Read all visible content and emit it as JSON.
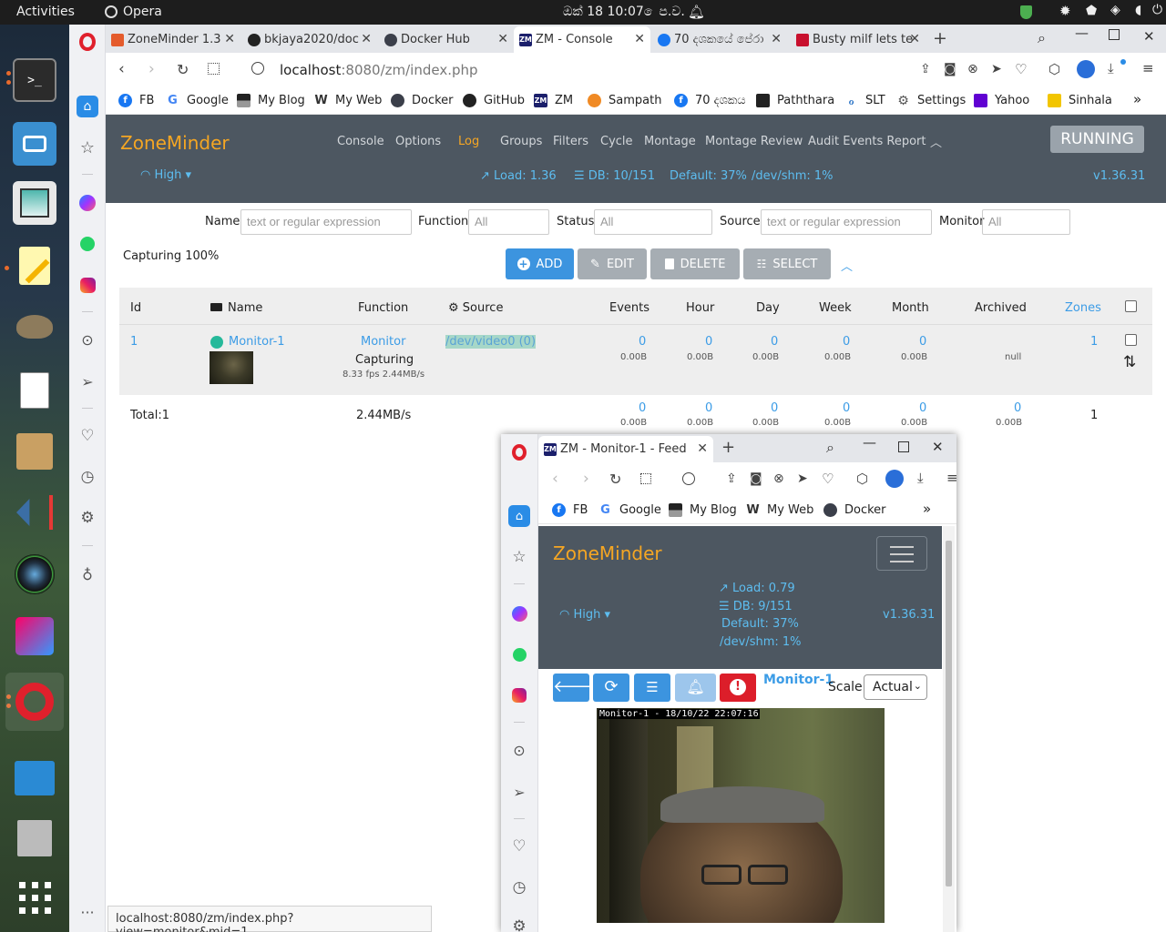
{
  "topbar": {
    "activities": "Activities",
    "app": "Opera",
    "clock": "ඔක් 18  10:07 ෙප.ව."
  },
  "tabs": [
    {
      "title": "ZoneMinder 1.3",
      "color": "#e45b2c"
    },
    {
      "title": "bkjaya2020/doc",
      "color": "#222222"
    },
    {
      "title": "Docker Hub",
      "color": "#3b3f4a"
    },
    {
      "title": "ZM - Console",
      "color": "#1b1f6b"
    },
    {
      "title": "70 දශකයේ පේරා",
      "color": "#1877f2"
    },
    {
      "title": "Busty milf lets te",
      "color": "#c8102e"
    }
  ],
  "address": {
    "host": "localhost",
    "rest": ":8080/zm/index.php"
  },
  "bookmarks": [
    {
      "label": "FB",
      "color": "#1877f2",
      "glyph": "f"
    },
    {
      "label": "Google",
      "color": "#ffffff",
      "glyph": "G"
    },
    {
      "label": "My Blog",
      "color": "#222222",
      "glyph": ""
    },
    {
      "label": "My Web",
      "color": "#ffffff",
      "glyph": "W"
    },
    {
      "label": "Docker",
      "color": "#3b3f4a",
      "glyph": ""
    },
    {
      "label": "GitHub",
      "color": "#222222",
      "glyph": ""
    },
    {
      "label": "ZM",
      "color": "#1b1f6b",
      "glyph": "ZM"
    },
    {
      "label": "Sampath",
      "color": "#f08a24",
      "glyph": ""
    },
    {
      "label": "70 දශකය",
      "color": "#1877f2",
      "glyph": "f"
    },
    {
      "label": "Paththara",
      "color": "#222222",
      "glyph": ""
    },
    {
      "label": "SLT",
      "color": "#ffffff",
      "glyph": ""
    },
    {
      "label": "Settings",
      "color": "#ffffff",
      "glyph": "⚙"
    },
    {
      "label": "Yahoo",
      "color": "#6001d2",
      "glyph": ""
    },
    {
      "label": "Sinhala",
      "color": "#f2c500",
      "glyph": ""
    }
  ],
  "zm": {
    "brand": "ZoneMinder",
    "nav": [
      "Console",
      "Options",
      "Log",
      "Groups",
      "Filters",
      "Cycle",
      "Montage",
      "Montage Review",
      "Audit Events Report"
    ],
    "state": "RUNNING",
    "bandwidth": "High",
    "load": "Load: 1.36",
    "db": "DB: 10/151",
    "default": "Default: 37%",
    "shm": "/dev/shm: 1%",
    "version": "v1.36.31",
    "accent": "#f5a623"
  },
  "filter": {
    "name_label": "Name",
    "name_ph": "text or regular expression",
    "function_label": "Function",
    "function_ph": "All",
    "status_label": "Status",
    "status_ph": "All",
    "source_label": "Source",
    "source_ph": "text or regular expression",
    "monitor_label": "Monitor",
    "monitor_ph": "All"
  },
  "capturing": "Capturing 100%",
  "actions": {
    "add": "ADD",
    "edit": "EDIT",
    "delete": "DELETE",
    "select": "SELECT"
  },
  "table": {
    "headers": [
      "Id",
      "Name",
      "Function",
      "Source",
      "Events",
      "Hour",
      "Day",
      "Week",
      "Month",
      "Archived",
      "Zones"
    ],
    "row": {
      "id": "1",
      "name": "Monitor-1",
      "function": "Monitor",
      "status": "Capturing",
      "rate": "8.33 fps 2.44MB/s",
      "source": "/dev/video0 (0)",
      "counts": [
        "0",
        "0",
        "0",
        "0",
        "0"
      ],
      "sizes": [
        "0.00B",
        "0.00B",
        "0.00B",
        "0.00B",
        "0.00B"
      ],
      "archived": "null",
      "zones": "1"
    },
    "total": {
      "label": "Total:1",
      "bandwidth": "2.44MB/s",
      "counts": [
        "0",
        "0",
        "0",
        "0",
        "0",
        "0"
      ],
      "sizes": [
        "0.00B",
        "0.00B",
        "0.00B",
        "0.00B",
        "0.00B",
        "0.00B"
      ],
      "zones": "1"
    }
  },
  "popup": {
    "tab_title": "ZM - Monitor-1 - Feed",
    "bookmarks": [
      "FB",
      "Google",
      "My Blog",
      "My Web",
      "Docker"
    ],
    "brand": "ZoneMinder",
    "load": "Load: 0.79",
    "db": "DB: 9/151",
    "default": "Default: 37%",
    "shm": "/dev/shm: 1%",
    "bandwidth": "High",
    "version": "v1.36.31",
    "monitor": "Monitor-1",
    "scale_label": "Scale:",
    "scale_value": "Actual",
    "overlay": "Monitor-1 - 18/10/22 22:07:16"
  },
  "status_url": "localhost:8080/zm/index.php?view=monitor&mid=1"
}
